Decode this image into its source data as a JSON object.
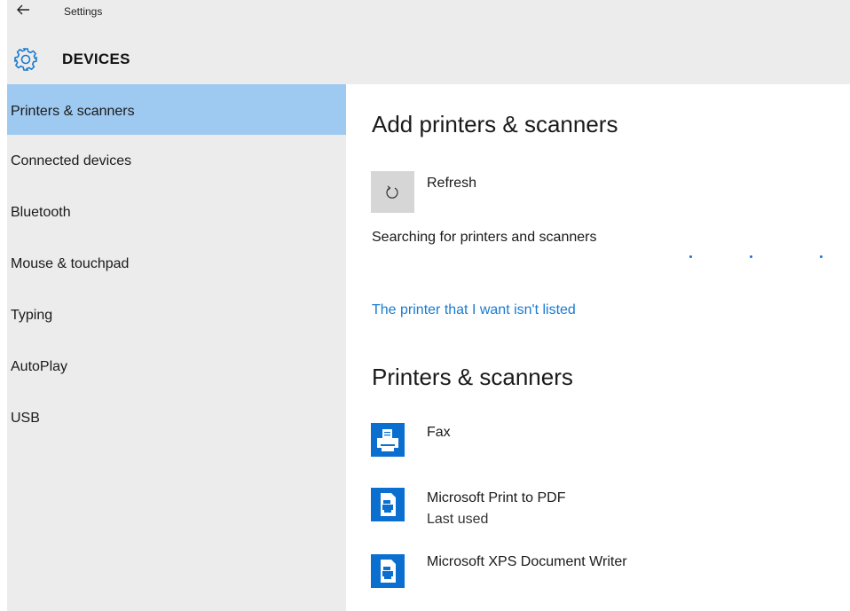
{
  "header": {
    "app_title": "Settings",
    "section_title": "DEVICES"
  },
  "sidebar": {
    "items": [
      {
        "label": "Printers & scanners",
        "selected": true
      },
      {
        "label": "Connected devices"
      },
      {
        "label": "Bluetooth"
      },
      {
        "label": "Mouse & touchpad"
      },
      {
        "label": "Typing"
      },
      {
        "label": "AutoPlay"
      },
      {
        "label": "USB"
      }
    ]
  },
  "main": {
    "add_heading": "Add printers & scanners",
    "refresh_label": "Refresh",
    "searching_text": "Searching for printers and scanners",
    "not_listed_link": "The printer that I want isn't listed",
    "list_heading": "Printers & scanners",
    "printers": [
      {
        "name": "Fax",
        "icon": "fax-printer-icon"
      },
      {
        "name": "Microsoft Print to PDF",
        "status": "Last used",
        "icon": "document-printer-icon"
      },
      {
        "name": "Microsoft XPS Document Writer",
        "icon": "document-printer-icon"
      }
    ]
  },
  "colors": {
    "accent": "#0b6fd0",
    "selected_bg": "#9ec9f0",
    "link": "#1a7ad0",
    "pane_bg": "#ececec"
  }
}
